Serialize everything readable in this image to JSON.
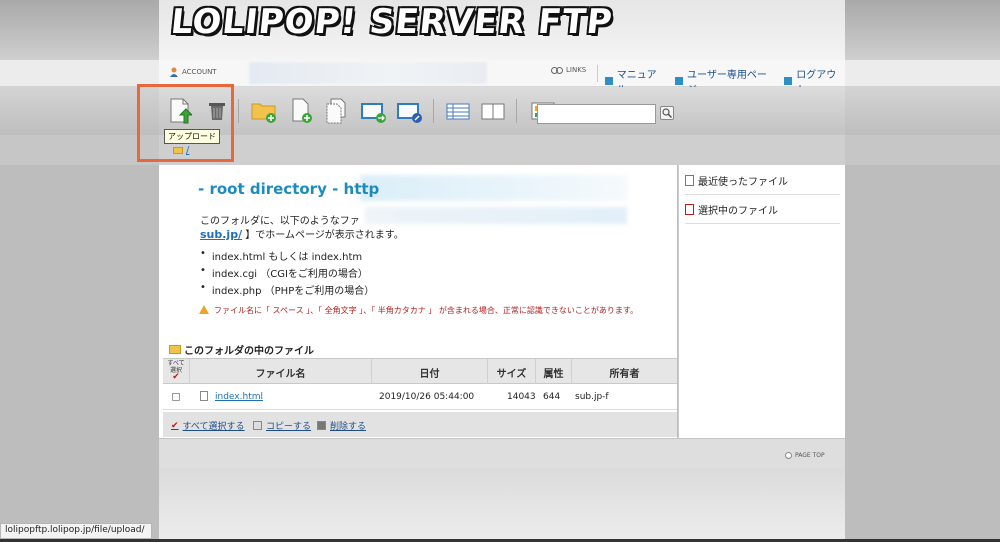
{
  "header": {
    "logo_text": "LOLIPOP! SERVER FTP",
    "account_label": "ACCOUNT",
    "links_label": "LINKS",
    "nav_links": [
      "マニュアル",
      "ユーザー専用ページ",
      "ログアウト"
    ]
  },
  "toolbar": {
    "buttons": [
      {
        "name": "upload-button",
        "icon": "upload-icon",
        "tooltip": "アップロード"
      },
      {
        "name": "delete-button",
        "icon": "trash-icon"
      },
      {
        "name": "new-folder-button",
        "icon": "folder-add-icon"
      },
      {
        "name": "new-file-button",
        "icon": "file-add-icon"
      },
      {
        "name": "copy-button",
        "icon": "copy-icon"
      },
      {
        "name": "move-button",
        "icon": "move-icon"
      },
      {
        "name": "rename-button",
        "icon": "rename-icon"
      },
      {
        "name": "list-view-button",
        "icon": "list-view-icon"
      },
      {
        "name": "column-view-button",
        "icon": "column-view-icon"
      },
      {
        "name": "thumbnail-view-button",
        "icon": "thumbnail-view-icon"
      }
    ],
    "tooltip": "アップロード",
    "search_placeholder": ""
  },
  "path": {
    "current": "/"
  },
  "content": {
    "heading": "- root directory - http",
    "desc_line1": "このフォルダに、以下のようなファ",
    "desc_link": "sub.jp/",
    "desc_line2": " 】でホームページが表示されます。",
    "bullets": [
      "index.html もしくは index.htm",
      "index.cgi （CGIをご利用の場合）",
      "index.php （PHPをご利用の場合）"
    ],
    "warning": "ファイル名に「 スペース 」、「 全角文字 」、「 半角カタカナ 」 が含まれる場合、正常に認識できないことがあります。",
    "section_title": "このフォルダの中のファイル"
  },
  "table": {
    "select_all_label": "すべて選択",
    "columns": [
      "ファイル名",
      "日付",
      "サイズ",
      "属性",
      "所有者"
    ],
    "rows": [
      {
        "name": "index.html",
        "date": "2019/10/26 05:44:00",
        "size": "14043",
        "perm": "644",
        "owner": "sub.jp-f"
      }
    ]
  },
  "actions": {
    "select_all": "すべて選択する",
    "copy": "コピーする",
    "delete": "削除する"
  },
  "sidebar": {
    "recent": "最近使ったファイル",
    "selected": "選択中のファイル"
  },
  "footer": {
    "page_top": "PAGE TOP"
  },
  "status_url": "lolipopftp.lolipop.jp/file/upload/",
  "colors": {
    "accent": "#1c8cc0",
    "highlight": "#e8683d",
    "warning": "#b02020"
  }
}
